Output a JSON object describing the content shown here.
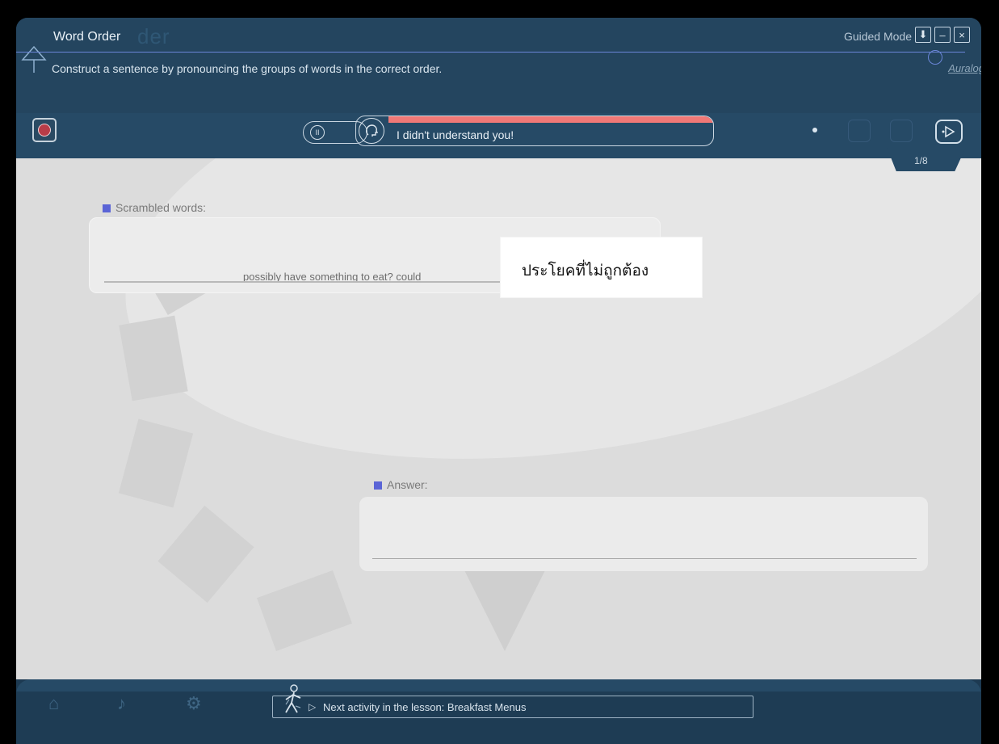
{
  "window": {
    "title": "Word Order",
    "ghost_title": "der",
    "subtitle": "Construct a sentence by pronouncing the groups of words in the correct order.",
    "mode": "Guided Mode",
    "brand": "Auralog",
    "buttons": {
      "download": "⬇",
      "minimize": "–",
      "close": "×"
    }
  },
  "toolbar": {
    "speech_feedback": "I didn't understand you!",
    "pause_icon": "II",
    "counter": "1/8"
  },
  "main": {
    "scrambled_label": "Scrambled words:",
    "scrambled_text": "possibly  have  something  to  eat?   could",
    "overlay_note": "ประโยคที่ไม่ถูกต้อง",
    "answer_label": "Answer:"
  },
  "bottom": {
    "next_activity": "Next activity in the lesson: Breakfast Menus"
  },
  "colors": {
    "accent": "#5a64d6",
    "feedback_red": "#f07876",
    "panel": "#264a66"
  }
}
